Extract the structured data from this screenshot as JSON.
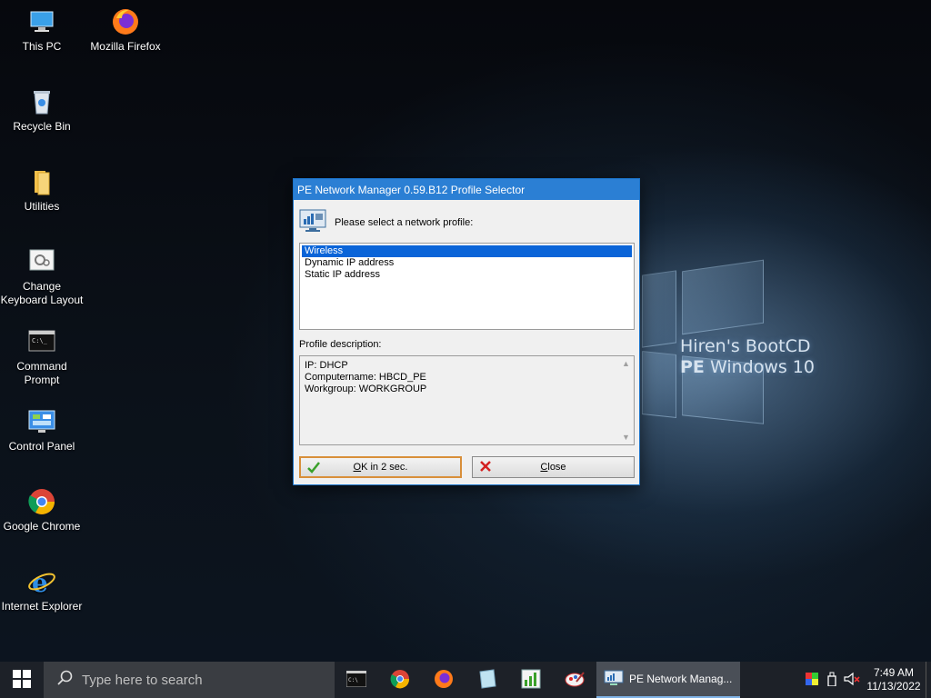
{
  "desktop": {
    "brand_line1": "Hiren's BootCD",
    "brand_line2_bold": "PE",
    "brand_line2_rest": " Windows 10",
    "icons": [
      {
        "label": "This PC",
        "icon": "computer-icon"
      },
      {
        "label": "Mozilla Firefox",
        "icon": "firefox-icon"
      },
      {
        "label": "Recycle Bin",
        "icon": "recycle-bin-icon"
      },
      {
        "label": "Utilities",
        "icon": "folder-icon"
      },
      {
        "label": "Change Keyboard Layout",
        "icon": "keyboard-settings-icon"
      },
      {
        "label": "Command Prompt",
        "icon": "terminal-icon"
      },
      {
        "label": "Control Panel",
        "icon": "control-panel-icon"
      },
      {
        "label": "Google Chrome",
        "icon": "chrome-icon"
      },
      {
        "label": "Internet Explorer",
        "icon": "internet-explorer-icon"
      }
    ]
  },
  "dialog": {
    "title": "PE Network Manager 0.59.B12 Profile Selector",
    "prompt": "Please select a network profile:",
    "profiles": [
      "Wireless",
      "Dynamic IP address",
      "Static IP address"
    ],
    "selected_index": 0,
    "description_label": "Profile description:",
    "description_lines": [
      "IP: DHCP",
      "Computername: HBCD_PE",
      "Workgroup: WORKGROUP"
    ],
    "ok_button_mnemonic": "O",
    "ok_button_rest": "K in 2 sec.",
    "close_button_mnemonic": "C",
    "close_button_rest": "lose"
  },
  "taskbar": {
    "search_placeholder": "Type here to search",
    "pinned": [
      "terminal-icon",
      "chrome-icon",
      "firefox-icon",
      "notepad-icon",
      "chart-icon",
      "paint-icon"
    ],
    "active_window_label": "PE Network Manag...",
    "clock_time": "7:49 AM",
    "clock_date": "11/13/2022"
  },
  "colors": {
    "accent": "#2b7fd4",
    "selection": "#0a64d8",
    "ok_border": "#d88f3a",
    "taskbar": "#1d2128"
  }
}
